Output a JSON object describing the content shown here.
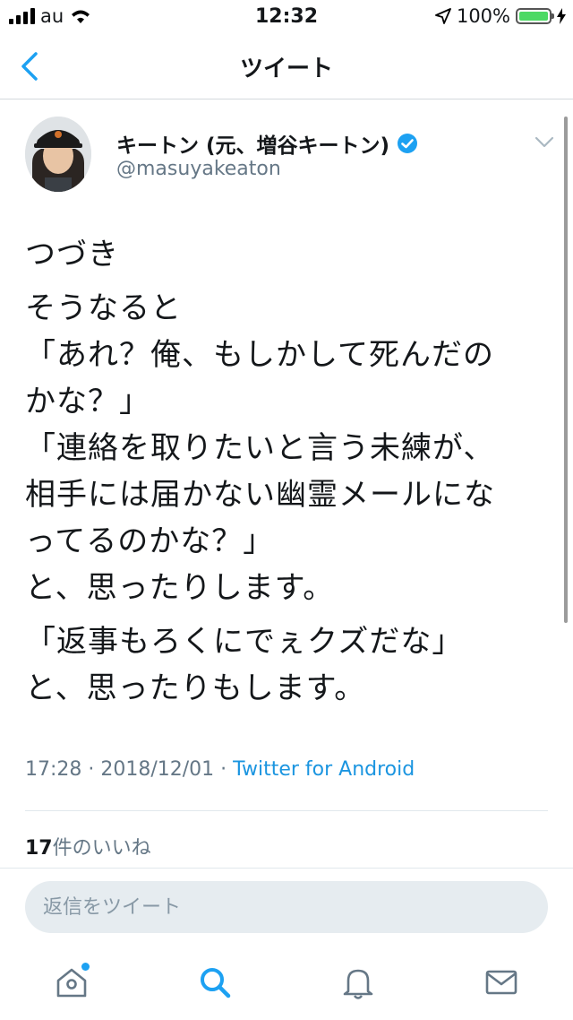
{
  "status_bar": {
    "carrier": "au",
    "time": "12:32",
    "battery": "100%"
  },
  "nav": {
    "title": "ツイート"
  },
  "tweet": {
    "author_name": "キートン (元、増谷キートン)",
    "handle": "@masuyakeaton",
    "lines": [
      "つづき",
      "そうなると\n「あれ？俺、もしかして死んだの\nかな？」\n「連絡を取りたいと言う未練が、\n相手には届かない幽霊メールにな\nってるのかな？」\nと、思ったりします。",
      "「返事もろくにでぇクズだな」\nと、思ったりもします。"
    ],
    "timestamp": "17:28 · 2018/12/01 · ",
    "source": "Twitter for Android",
    "likes_count": "17",
    "likes_label": "件のいいね"
  },
  "reply": {
    "placeholder": "返信をツイート"
  },
  "tabbar": {
    "items": [
      "home-icon",
      "search-icon",
      "notifications-icon",
      "messages-icon"
    ]
  },
  "colors": {
    "accent": "#1da1f2",
    "verified": "#1da1f2",
    "secondary_text": "#657786",
    "battery": "#4cd964"
  }
}
